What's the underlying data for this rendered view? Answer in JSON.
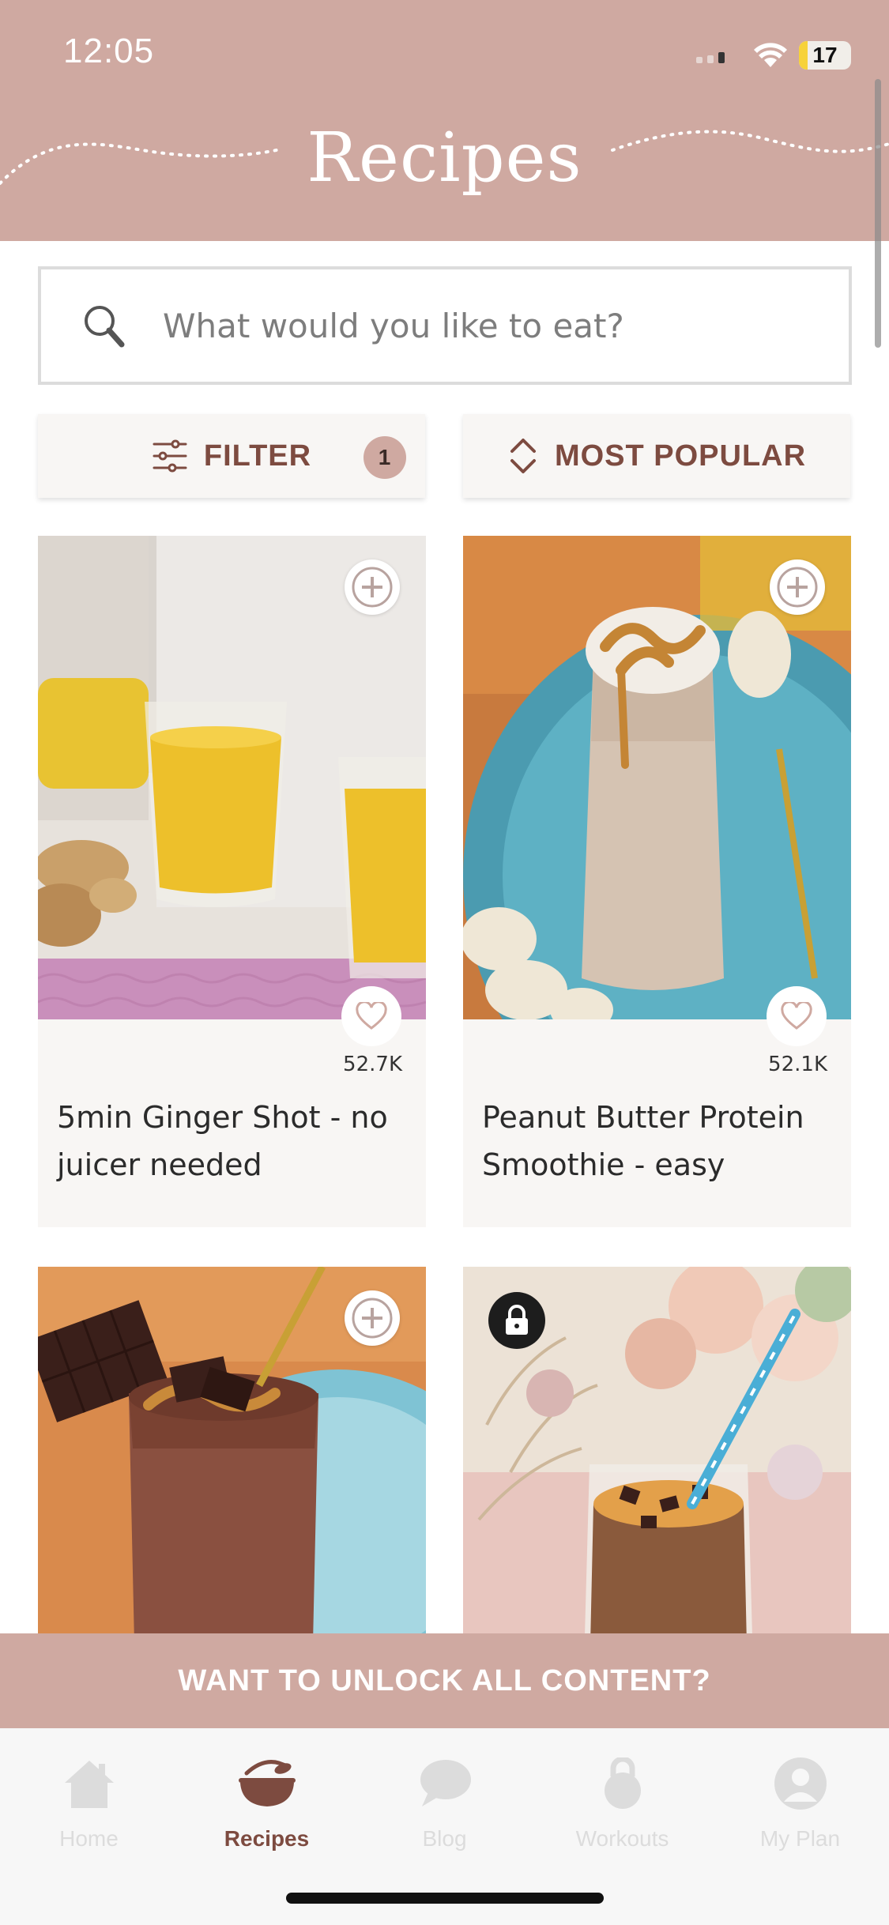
{
  "status_bar": {
    "time": "12:05",
    "battery_level": "17",
    "battery_fraction": 0.17
  },
  "header": {
    "title": "Recipes"
  },
  "search": {
    "placeholder": "What would you like to eat?"
  },
  "filter": {
    "label": "FILTER",
    "count": "1"
  },
  "sort": {
    "label": "MOST POPULAR"
  },
  "recipes": [
    {
      "title": "5min Ginger Shot - no juicer needed",
      "likes": "52.7K"
    },
    {
      "title": "Peanut Butter Protein Smoothie - easy",
      "likes": "52.1K"
    }
  ],
  "unlock_banner": {
    "label": "WANT TO UNLOCK ALL CONTENT?"
  },
  "tabs": [
    {
      "label": "Home",
      "icon": "home-icon"
    },
    {
      "label": "Recipes",
      "icon": "mixing-bowl-icon",
      "active": true
    },
    {
      "label": "Blog",
      "icon": "speech-bubble-icon"
    },
    {
      "label": "Workouts",
      "icon": "kettlebell-icon"
    },
    {
      "label": "My Plan",
      "icon": "profile-icon"
    }
  ],
  "colors": {
    "brand": "#cfa9a1",
    "accent_text": "#7d4b40",
    "card_bg": "#f8f6f4"
  }
}
